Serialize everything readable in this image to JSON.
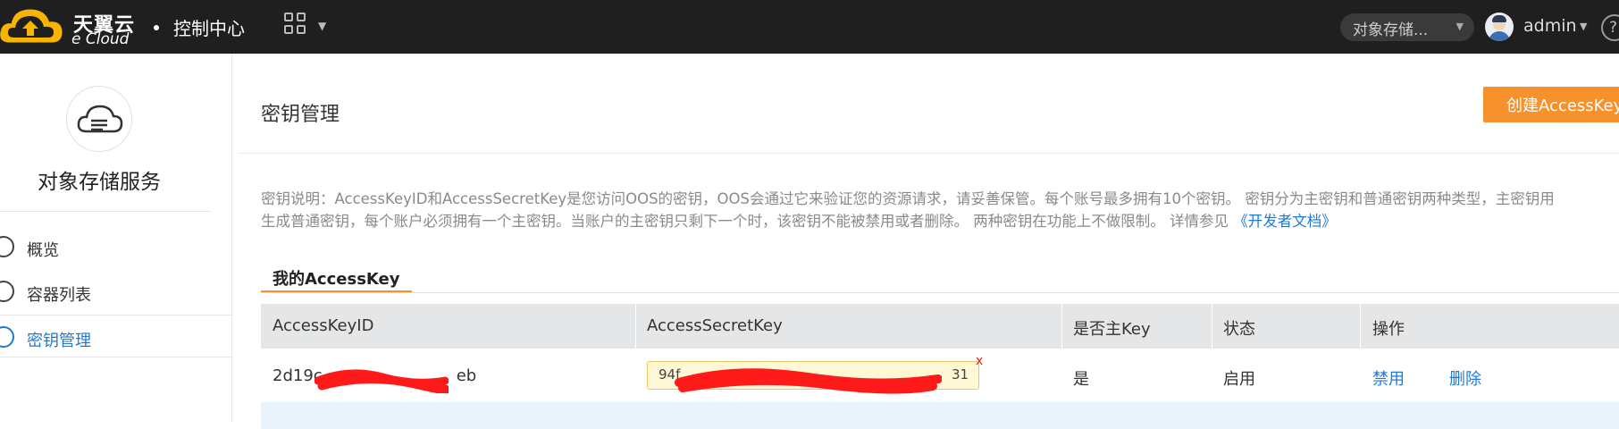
{
  "header": {
    "logo_cn": "天翼云",
    "logo_en": "e Cloud",
    "console_title": "控制中心",
    "service_select": "对象存储...",
    "user_name": "admin",
    "help_glyph": "?"
  },
  "sidebar": {
    "service_title": "对象存储服务",
    "items": [
      {
        "label": "概览",
        "icon": "overview-icon",
        "active": false
      },
      {
        "label": "容器列表",
        "icon": "container-icon",
        "active": false
      },
      {
        "label": "密钥管理",
        "icon": "key-icon",
        "active": true
      }
    ]
  },
  "main": {
    "title": "密钥管理",
    "create_button": "创建AccessKey",
    "description_line1": "密钥说明：AccessKeyID和AccessSecretKey是您访问OOS的密钥，OOS会通过它来验证您的资源请求，请妥善保管。每个账号最多拥有10个密钥。 密钥分为主密钥和普通密钥两种类型，主密钥用",
    "description_line2": "生成普通密钥，每个账户必须拥有一个主密钥。当账户的主密钥只剩下一个时，该密钥不能被禁用或者删除。 两种密钥在功能上不做限制。 详情参见 ",
    "developer_doc_link": "《开发者文档》",
    "tab_label": "我的AccessKey",
    "table": {
      "headers": [
        "AccessKeyID",
        "AccessSecretKey",
        "是否主Key",
        "状态",
        "操作"
      ],
      "rows": [
        {
          "access_key_id": "2d19c",
          "access_key_id_tail": "eb",
          "secret_key_head": "94f",
          "secret_key_tail": "31",
          "secret_close": "x",
          "is_primary": "是",
          "status": "启用",
          "op_disable": "禁用",
          "op_delete": "删除"
        }
      ]
    }
  },
  "colors": {
    "topbar": "#1f1f1f",
    "accent_orange": "#f6912c",
    "link_blue": "#1e7ad8",
    "redaction_red": "#ff1a1a"
  }
}
